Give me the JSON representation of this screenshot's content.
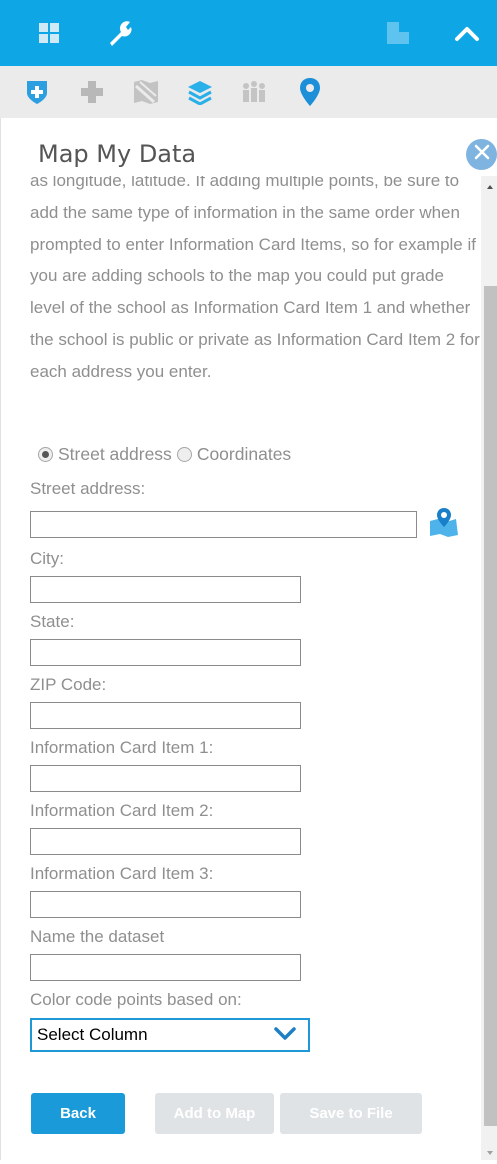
{
  "panel": {
    "title": "Map My Data"
  },
  "description": "as longitude, latitude. If adding multiple points, be sure to add the same type of information in the same order when prompted to enter Information Card Items, so for example if you are adding schools to the map you could put grade level of the school as Information Card Item 1 and whether the school is public or private as Information Card Item 2 for each address you enter.",
  "address_mode": {
    "options": [
      "Street address",
      "Coordinates"
    ],
    "selected": "Street address"
  },
  "form": {
    "street_address": "Street address:",
    "city": "City:",
    "state": "State:",
    "zip": "ZIP Code:",
    "info1": "Information Card Item 1:",
    "info2": "Information Card Item 2:",
    "info3": "Information Card Item 3:",
    "dataset_name": "Name the dataset",
    "color_code": "Color code points based on:",
    "select_value": "Select Column"
  },
  "buttons": {
    "back": "Back",
    "add_to_map": "Add to Map",
    "save_to_file": "Save to File"
  },
  "colors": {
    "accent": "#0fa6e6",
    "button_primary": "#1a9ad8",
    "button_disabled": "#dfe3e6"
  }
}
